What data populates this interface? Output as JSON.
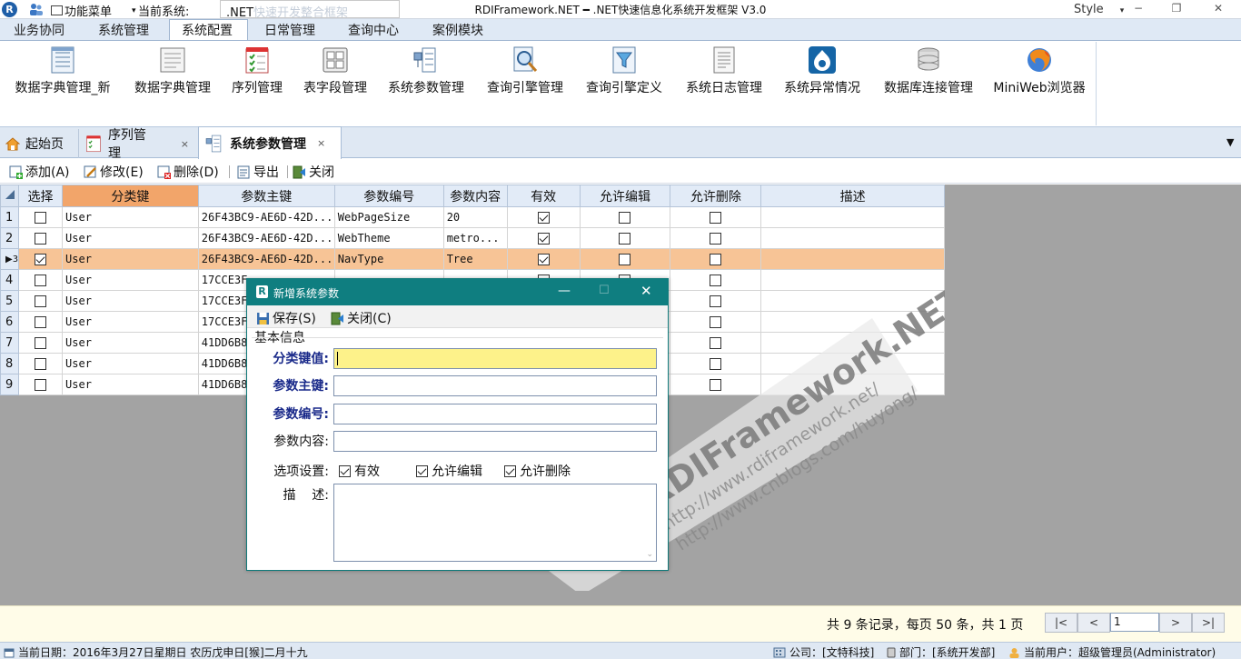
{
  "titlebar": {
    "app_icon": "R",
    "qa_menu": "功能菜单",
    "current_system_label": "当前系统:",
    "system_value": ".NET",
    "system_value_ghost": "快速开发整合框架",
    "window_title": "RDIFramework.NET ━ .NET快速信息化系统开发框架 V3.0",
    "style_label": "Style",
    "min": "−",
    "max": "❐",
    "close": "✕"
  },
  "ribbon": {
    "tabs": [
      "业务协同",
      "系统管理",
      "系统配置",
      "日常管理",
      "查询中心",
      "案例模块"
    ],
    "active_tab": "系统配置",
    "buttons": [
      {
        "label": "数据字典管理_新",
        "icon": "document-list-icon"
      },
      {
        "label": "数据字典管理",
        "icon": "document-lines-icon"
      },
      {
        "label": "序列管理",
        "icon": "checklist-icon"
      },
      {
        "label": "表字段管理",
        "icon": "grid-table-icon"
      },
      {
        "label": "系统参数管理",
        "icon": "tree-params-icon"
      },
      {
        "label": "查询引擎管理",
        "icon": "magnifier-doc-icon"
      },
      {
        "label": "查询引擎定义",
        "icon": "filter-doc-icon"
      },
      {
        "label": "系统日志管理",
        "icon": "log-doc-icon"
      },
      {
        "label": "系统异常情况",
        "icon": "drupal-icon"
      },
      {
        "label": "数据库连接管理",
        "icon": "database-icon"
      },
      {
        "label": "MiniWeb浏览器",
        "icon": "firefox-globe-icon"
      }
    ]
  },
  "doctabs": {
    "tabs": [
      {
        "label": "起始页",
        "closable": false
      },
      {
        "label": "序列管理",
        "closable": true
      },
      {
        "label": "系统参数管理",
        "closable": true,
        "active": true
      }
    ],
    "close": "×",
    "dropdown": "▼"
  },
  "toolbar": {
    "add": "添加(A)",
    "edit": "修改(E)",
    "delete": "删除(D)",
    "export": "导出",
    "close": "关闭"
  },
  "grid": {
    "columns": [
      "选择",
      "分类键",
      "参数主键",
      "参数编号",
      "参数内容",
      "有效",
      "允许编辑",
      "允许删除",
      "描述"
    ],
    "rows": [
      {
        "n": "1",
        "cat": "User",
        "id": "26F43BC9-AE6D-42D...",
        "code": "WebPageSize",
        "content": "20",
        "valid": true,
        "edit": false,
        "del": false,
        "desc": ""
      },
      {
        "n": "2",
        "cat": "User",
        "id": "26F43BC9-AE6D-42D...",
        "code": "WebTheme",
        "content": "metro...",
        "valid": true,
        "edit": false,
        "del": false,
        "desc": ""
      },
      {
        "n": "3",
        "cat": "User",
        "id": "26F43BC9-AE6D-42D...",
        "code": "NavType",
        "content": "Tree",
        "valid": true,
        "edit": false,
        "del": false,
        "desc": "",
        "selected": true,
        "checked": true
      },
      {
        "n": "4",
        "cat": "User",
        "id": "17CCE3F",
        "code": "",
        "content": "",
        "valid": false,
        "edit": false,
        "del": false,
        "desc": ""
      },
      {
        "n": "5",
        "cat": "User",
        "id": "17CCE3F",
        "code": "",
        "content": "",
        "valid": false,
        "edit": false,
        "del": false,
        "desc": ""
      },
      {
        "n": "6",
        "cat": "User",
        "id": "17CCE3F",
        "code": "",
        "content": "",
        "valid": false,
        "edit": false,
        "del": false,
        "desc": ""
      },
      {
        "n": "7",
        "cat": "User",
        "id": "41DD6B8",
        "code": "",
        "content": "",
        "valid": false,
        "edit": false,
        "del": false,
        "desc": ""
      },
      {
        "n": "8",
        "cat": "User",
        "id": "41DD6B8",
        "code": "",
        "content": "",
        "valid": false,
        "edit": false,
        "del": false,
        "desc": ""
      },
      {
        "n": "9",
        "cat": "User",
        "id": "41DD6B8",
        "code": "",
        "content": "",
        "valid": false,
        "edit": false,
        "del": false,
        "desc": ""
      }
    ]
  },
  "pager": {
    "summary": "共 9 条记录，每页 50 条，共 1 页",
    "page": "1",
    "first": "|<",
    "prev": "<",
    "next": ">",
    "last": ">|"
  },
  "status": {
    "date": "当前日期：2016年3月27日星期日 农历戊申日[猴]二月十九",
    "company": "公司：[文特科技]",
    "dept": "部门：[系统开发部]",
    "user": "当前用户：超级管理员(Administrator)"
  },
  "dialog": {
    "title": "新增系统参数",
    "save": "保存(S)",
    "close": "关闭(C)",
    "group": "基本信息",
    "fields": {
      "category": "分类键值:",
      "key": "参数主键:",
      "code": "参数编号:",
      "content": "参数内容:",
      "options": "选项设置:",
      "desc": "描    述:"
    },
    "options": [
      {
        "label": "有效",
        "checked": true
      },
      {
        "label": "允许编辑",
        "checked": true
      },
      {
        "label": "允许删除",
        "checked": true
      }
    ],
    "min": "—",
    "max": "☐",
    "x": "✕"
  },
  "watermark": {
    "brand": "RDIFramework.NET",
    "url1": "http://www.rdiframework.net/",
    "url2": "http://www.cnblogs.com/huyong/"
  },
  "colors": {
    "ribbon_bg": "#dfe9f5",
    "selected_row": "#f7c496",
    "sorted_header": "#f2a56a",
    "dialog_title": "#0f7e80",
    "required_field": "#fdf28a",
    "pager_bg": "#fffce8"
  }
}
